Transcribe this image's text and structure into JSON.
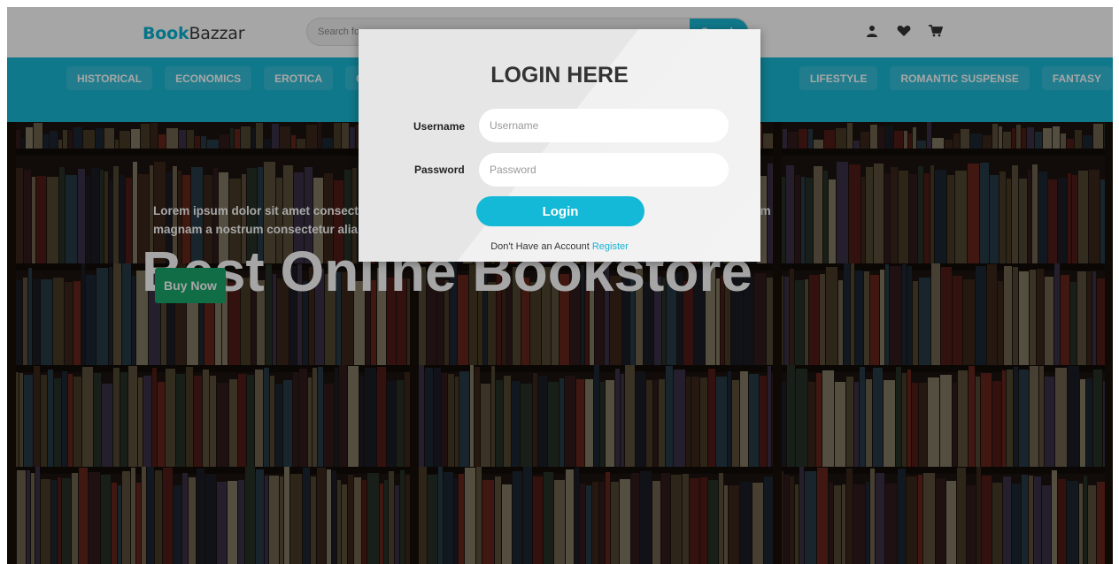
{
  "header": {
    "logo_part1": "Book",
    "logo_part2": "Bazzar",
    "search_placeholder": "Search for",
    "search_button": "Search",
    "icons": [
      "user-icon",
      "heart-icon",
      "cart-icon"
    ]
  },
  "nav": {
    "items": [
      {
        "label": "HISTORICAL"
      },
      {
        "label": "ECONOMICS"
      },
      {
        "label": "EROTICA"
      },
      {
        "label": "CRIME"
      },
      {
        "label": "LIFESTYLE"
      },
      {
        "label": "ROMANTIC SUSPENSE"
      },
      {
        "label": "FANTASY"
      }
    ]
  },
  "hero": {
    "title": "Best Online Bookstore",
    "text": "Lorem ipsum dolor sit amet consectetur adipisicing elit. Ducimus omnis, minima tempore illum fuga aperiam magnam a nostrum consectetur alias.",
    "button": "Buy Now"
  },
  "login": {
    "title": "LOGIN HERE",
    "username_label": "Username",
    "username_placeholder": "Username",
    "password_label": "Password",
    "password_placeholder": "Password",
    "button": "Login",
    "register_prompt": "Don't Have an Account",
    "register_link": "Register"
  },
  "colors": {
    "accent": "#18b8d4",
    "buy": "#1aa86b",
    "overlay": "rgba(0,0,0,0.35)"
  }
}
